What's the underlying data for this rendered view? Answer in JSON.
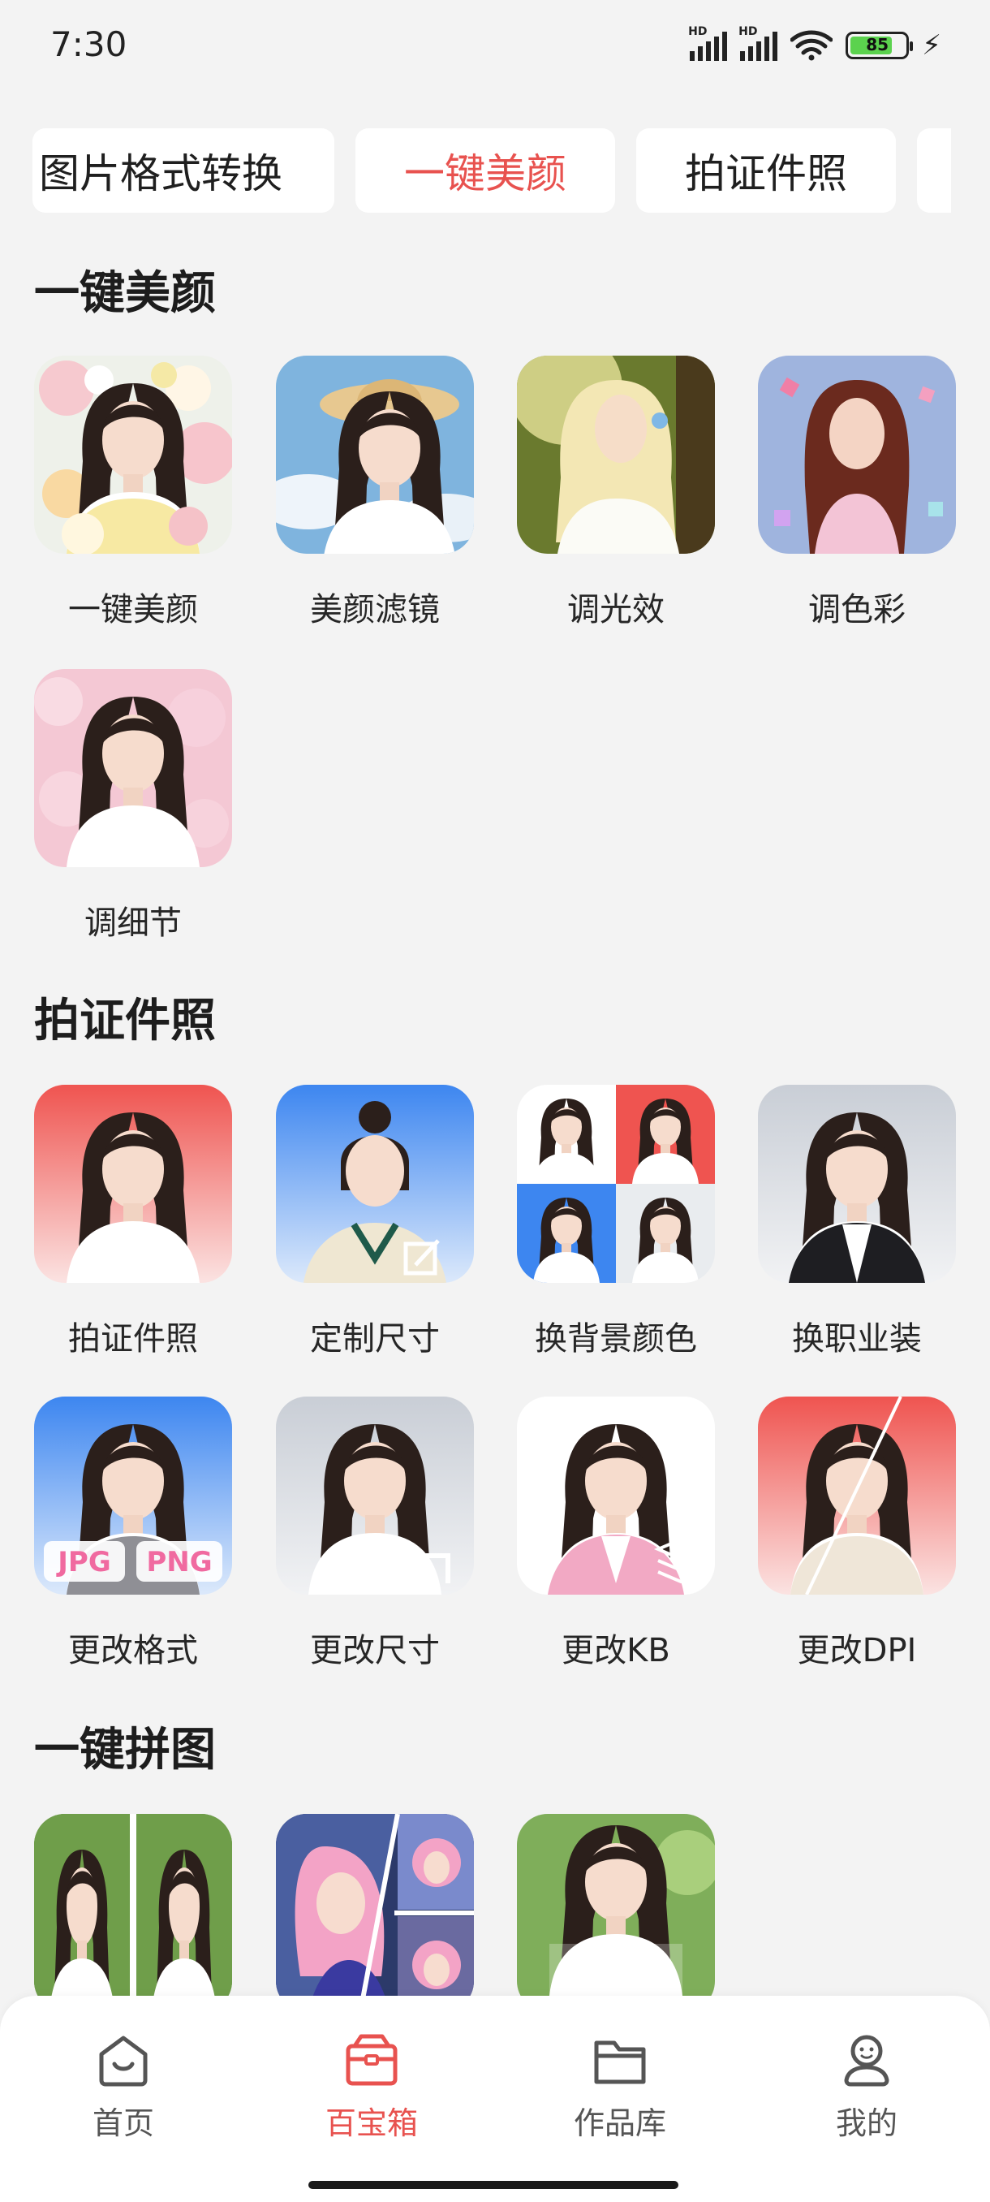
{
  "status_bar": {
    "time": "7:30",
    "battery": "85",
    "signal_1_label": "HD",
    "signal_2_label": "HD"
  },
  "top_tabs": [
    {
      "label": "图片格式转换"
    },
    {
      "label": "一键美颜",
      "active": true
    },
    {
      "label": "拍证件照"
    }
  ],
  "sections": {
    "beauty": {
      "title": "一键美颜",
      "items": [
        {
          "label": "一键美颜",
          "icon": "woman-with-flowers-thumbnail"
        },
        {
          "label": "美颜滤镜",
          "icon": "woman-in-sunhat-thumbnail"
        },
        {
          "label": "调光效",
          "icon": "blonde-woman-sunlight-thumbnail"
        },
        {
          "label": "调色彩",
          "icon": "woman-sparkle-dress-thumbnail"
        },
        {
          "label": "调细节",
          "icon": "woman-cherry-blossom-thumbnail"
        }
      ]
    },
    "id_photo": {
      "title": "拍证件照",
      "items": [
        {
          "label": "拍证件照",
          "icon": "id-photo-red-bg-thumbnail"
        },
        {
          "label": "定制尺寸",
          "icon": "id-photo-blue-bg-edit-thumbnail"
        },
        {
          "label": "换背景颜色",
          "icon": "background-color-grid-thumbnail"
        },
        {
          "label": "换职业装",
          "icon": "business-suit-thumbnail"
        },
        {
          "label": "更改格式",
          "icon": "jpg-png-format-thumbnail",
          "badge_1": "JPG",
          "badge_2": "PNG"
        },
        {
          "label": "更改尺寸",
          "icon": "resize-thumbnail"
        },
        {
          "label": "更改KB",
          "icon": "file-size-layers-thumbnail"
        },
        {
          "label": "更改DPI",
          "icon": "dpi-split-thumbnail"
        }
      ]
    },
    "collage": {
      "title": "一键拼图",
      "items": [
        {
          "icon": "two-panel-collage-thumbnail"
        },
        {
          "icon": "multi-panel-collage-thumbnail"
        },
        {
          "icon": "photo-with-text-thumbnail"
        }
      ]
    }
  },
  "bottom_nav": [
    {
      "label": "首页",
      "icon": "home-icon"
    },
    {
      "label": "百宝箱",
      "icon": "toolbox-icon",
      "active": true
    },
    {
      "label": "作品库",
      "icon": "folder-icon"
    },
    {
      "label": "我的",
      "icon": "profile-icon"
    }
  ],
  "colors": {
    "accent": "#e8524f",
    "background": "#f3f3f3"
  }
}
